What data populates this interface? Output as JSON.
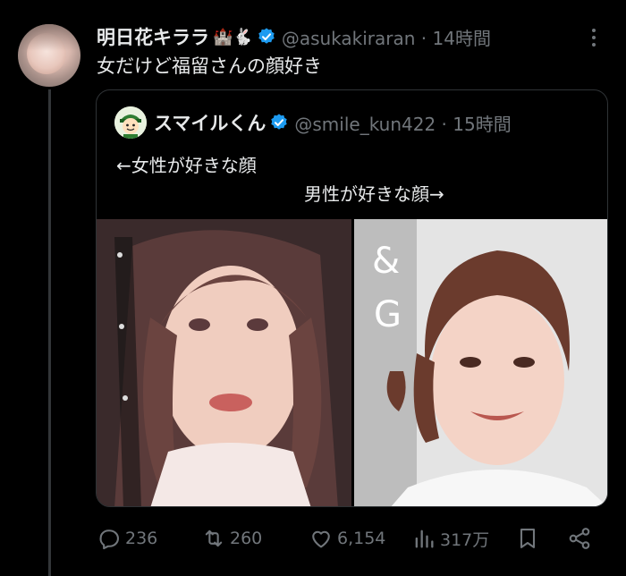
{
  "tweet": {
    "author_name": "明日花キララ",
    "author_emoji": "🏰🐇",
    "handle_time": "@asukakiraran · 14時間",
    "text": "女だけど福留さんの顔好き"
  },
  "quoted": {
    "author_name": "スマイルくん",
    "handle_time": "@smile_kun422 · 15時間",
    "line1": "←女性が好きな顔",
    "line2": "男性が好きな顔→"
  },
  "photo_marks": {
    "left_sign": "&",
    "right_sign": "&",
    "right_sign2": "G"
  },
  "actions": {
    "replies": "236",
    "reposts": "260",
    "likes": "6,154",
    "views": "317万"
  },
  "colors": {
    "background": "#000000",
    "text": "#e7e9ea",
    "secondary": "#71767b",
    "verified": "#1d9bf0",
    "border": "#2f3336"
  },
  "icons": [
    "verified-badge-icon",
    "more-icon",
    "reply-icon",
    "repost-icon",
    "like-icon",
    "views-icon",
    "bookmark-icon",
    "share-icon"
  ]
}
